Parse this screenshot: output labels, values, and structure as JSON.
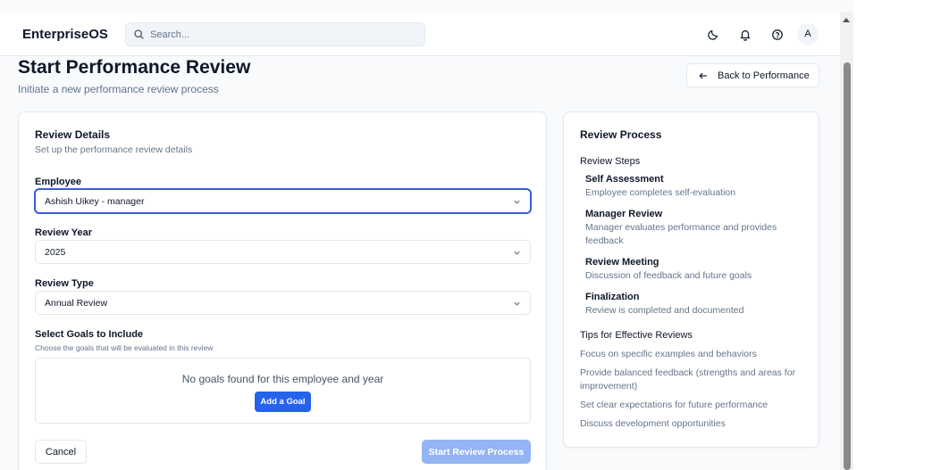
{
  "app": {
    "name": "EnterpriseOS",
    "search_placeholder": "Search...",
    "avatar_initial": "A",
    "icons": [
      "moon-icon",
      "bell-icon",
      "help-icon"
    ]
  },
  "page": {
    "title": "Start Performance Review",
    "subtitle": "Initiate a new performance review process",
    "back_label": "Back to Performance"
  },
  "review_details": {
    "title": "Review Details",
    "subtitle": "Set up the performance review details",
    "employee_label": "Employee",
    "employee_value": "Ashish Uikey - manager",
    "year_label": "Review Year",
    "year_value": "2025",
    "type_label": "Review Type",
    "type_value": "Annual Review",
    "goals_label": "Select Goals to Include",
    "goals_hint": "Choose the goals that will be evaluated in this review",
    "no_goals_text": "No goals found for this employee and year",
    "add_goal_label": "Add a Goal",
    "cancel_label": "Cancel",
    "start_label": "Start Review Process"
  },
  "review_process": {
    "title": "Review Process",
    "steps_heading": "Review Steps",
    "steps": [
      {
        "title": "Self Assessment",
        "desc": "Employee completes self-evaluation"
      },
      {
        "title": "Manager Review",
        "desc": "Manager evaluates performance and provides feedback"
      },
      {
        "title": "Review Meeting",
        "desc": "Discussion of feedback and future goals"
      },
      {
        "title": "Finalization",
        "desc": "Review is completed and documented"
      }
    ],
    "tips_heading": "Tips for Effective Reviews",
    "tips": [
      "Focus on specific examples and behaviors",
      "Provide balanced feedback (strengths and areas for improvement)",
      "Set clear expectations for future performance",
      "Discuss development opportunities"
    ]
  },
  "colors": {
    "primary": "#2563eb",
    "primary_disabled": "#93b4f5",
    "focus_ring": "#3b5bdb",
    "muted_text": "#64748b",
    "border": "#e2e8f0"
  }
}
